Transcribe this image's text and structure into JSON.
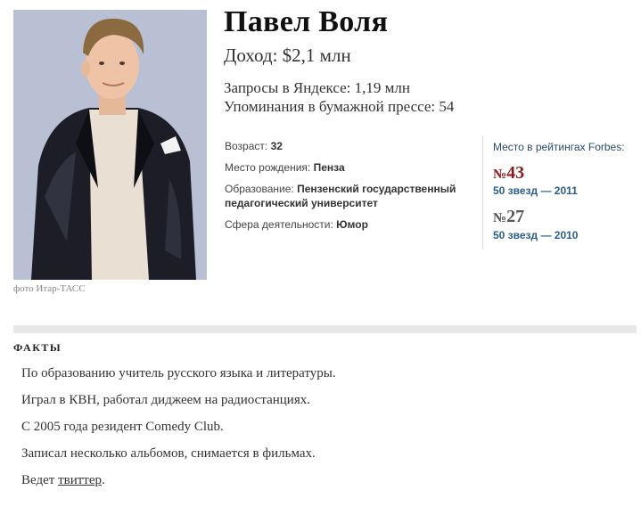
{
  "photo": {
    "alt": "Павел Воля",
    "credit": "фото Итар-ТАСС"
  },
  "person": {
    "name": "Павел Воля",
    "income_label": "Доход:",
    "income_value": "$2,1 млн",
    "yandex_label": "Запросы в Яндексе:",
    "yandex_value": "1,19 млн",
    "press_label": "Упоминания в бумажной прессе:",
    "press_value": "54"
  },
  "details": {
    "age_label": "Возраст:",
    "age_value": "32",
    "birthplace_label": "Место рождения:",
    "birthplace_value": "Пенза",
    "education_label": "Образование:",
    "education_value_line1": "Пензенский государственный",
    "education_value_line2": "педагогический университет",
    "field_label": "Сфера деятельности:",
    "field_value": "Юмор"
  },
  "rankings": {
    "title": "Место в рейтингах Forbes:",
    "items": [
      {
        "symbol": "№",
        "number": "43",
        "label": "50 звезд — 2011",
        "color": "#8b1a1a"
      },
      {
        "symbol": "№",
        "number": "27",
        "label": "50 звезд — 2010",
        "color": "#555555"
      }
    ]
  },
  "facts": {
    "title": "ФАКТЫ",
    "items": [
      "По образованию учитель русского языка и литературы.",
      "Играл в КВН, работал диджеем на радиостанциях.",
      "С 2005 года резидент Comedy Club.",
      "Записал несколько альбомов, снимается в фильмах."
    ],
    "last_prefix": "Ведет ",
    "last_link": "твиттер",
    "last_suffix": "."
  }
}
